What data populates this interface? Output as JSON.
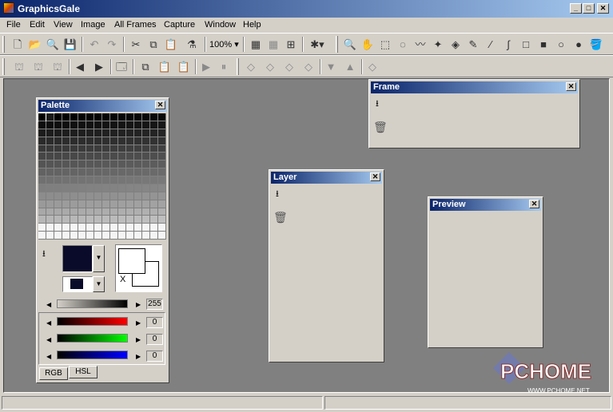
{
  "window": {
    "title": "GraphicsGale"
  },
  "menu": [
    "File",
    "Edit",
    "View",
    "Image",
    "All Frames",
    "Capture",
    "Window",
    "Help"
  ],
  "toolbar1": {
    "zoom": "100%"
  },
  "panels": {
    "frame": {
      "title": "Frame"
    },
    "layer": {
      "title": "Layer"
    },
    "preview": {
      "title": "Preview"
    },
    "palette": {
      "title": "Palette",
      "swap_label": "X",
      "gray_value": "255",
      "red_value": "0",
      "green_value": "0",
      "blue_value": "0",
      "tabs": [
        "RGB",
        "HSL"
      ]
    }
  },
  "watermark": {
    "text": "PCHOME",
    "url": "WWW.PCHOME.NET"
  },
  "colors": {
    "titlebar_start": "#0a246a",
    "titlebar_end": "#a6caf0",
    "workspace": "#808080"
  }
}
